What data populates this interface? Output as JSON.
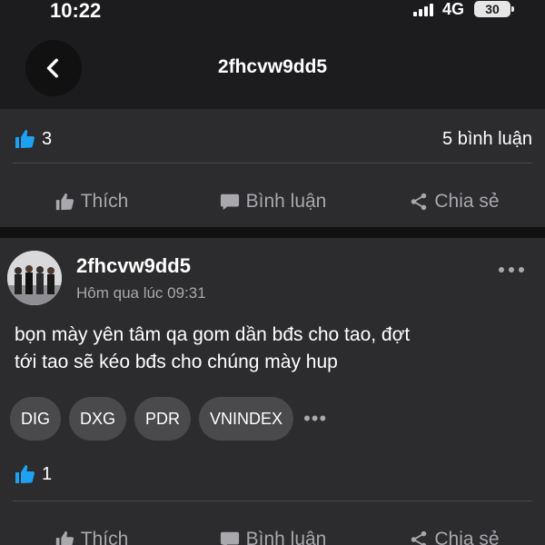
{
  "status_bar": {
    "time": "10:22",
    "network": "4G",
    "battery": "30"
  },
  "header": {
    "back_icon": "chevron-left-icon",
    "title": "2fhcvw9dd5"
  },
  "post_top": {
    "like_icon": "thumbs-up-icon",
    "like_count": "3",
    "comment_count": "5 bình luận",
    "actions": [
      {
        "icon": "thumbs-up-icon",
        "label": "Thích"
      },
      {
        "icon": "comment-icon",
        "label": "Bình luận"
      },
      {
        "icon": "share-icon",
        "label": "Chia sẻ"
      }
    ]
  },
  "post": {
    "author": "2fhcvw9dd5",
    "timestamp": "Hôm qua lúc 09:31",
    "more_icon": "more-horizontal-icon",
    "text_line1": "bọn mày yên tâm qa gom dần bđs cho tao, đợt",
    "text_line2": "tới tao sẽ kéo bđs cho chúng mày hup",
    "tags": [
      "DIG",
      "DXG",
      "PDR",
      "VNINDEX"
    ],
    "tags_more": "•••",
    "like_count": "1",
    "actions": [
      {
        "icon": "thumbs-up-icon",
        "label": "Thích"
      },
      {
        "icon": "comment-icon",
        "label": "Bình luận"
      },
      {
        "icon": "share-icon",
        "label": "Chia sẻ"
      }
    ]
  },
  "colors": {
    "background": "#1c1c1e",
    "card": "#2c2c2e",
    "accent_blue": "#1da1f2",
    "muted_text": "#a8a8ad"
  }
}
